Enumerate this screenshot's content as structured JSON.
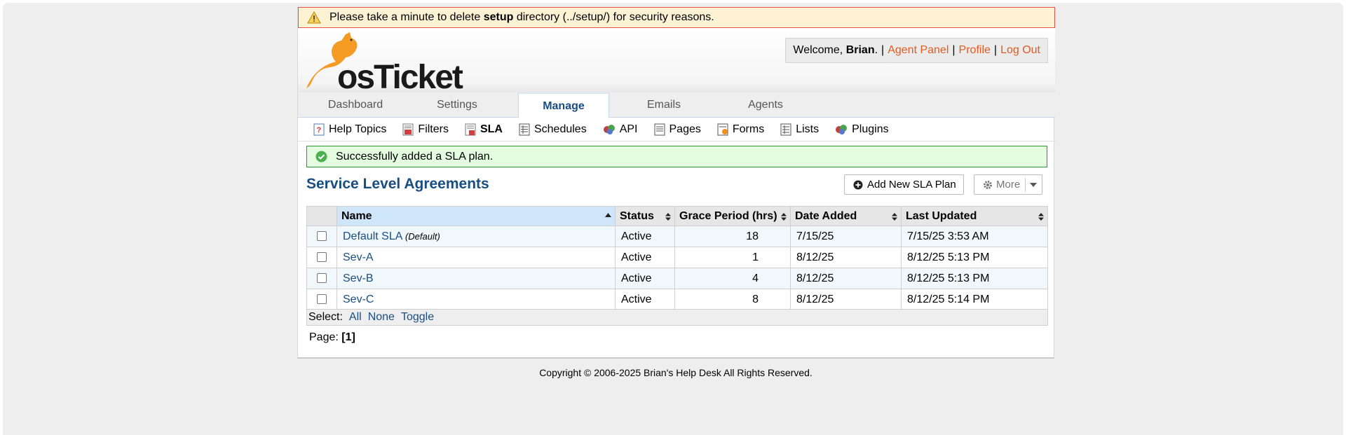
{
  "warning": {
    "prefix": "Please take a minute to delete",
    "bold": "setup",
    "suffix": "directory (../setup/) for security reasons."
  },
  "header": {
    "logo_text": "osTicket",
    "welcome_prefix": "Welcome,",
    "user_name": "Brian",
    "links": [
      "Agent Panel",
      "Profile",
      "Log Out"
    ]
  },
  "nav": {
    "tabs": [
      "Dashboard",
      "Settings",
      "Manage",
      "Emails",
      "Agents"
    ],
    "active": "Manage"
  },
  "subnav": {
    "items": [
      "Help Topics",
      "Filters",
      "SLA",
      "Schedules",
      "API",
      "Pages",
      "Forms",
      "Lists",
      "Plugins"
    ],
    "active": "SLA"
  },
  "success_message": "Successfully added a SLA plan.",
  "page_title": "Service Level Agreements",
  "buttons": {
    "add_label": "Add New SLA Plan",
    "more_label": "More"
  },
  "table": {
    "columns": [
      "Name",
      "Status",
      "Grace Period (hrs)",
      "Date Added",
      "Last Updated"
    ],
    "rows": [
      {
        "name": "Default SLA",
        "tag": "(Default)",
        "status": "Active",
        "grace": "18",
        "added": "7/15/25",
        "updated": "7/15/25 3:53 AM"
      },
      {
        "name": "Sev-A",
        "tag": "",
        "status": "Active",
        "grace": "1",
        "added": "8/12/25",
        "updated": "8/12/25 5:13 PM"
      },
      {
        "name": "Sev-B",
        "tag": "",
        "status": "Active",
        "grace": "4",
        "added": "8/12/25",
        "updated": "8/12/25 5:13 PM"
      },
      {
        "name": "Sev-C",
        "tag": "",
        "status": "Active",
        "grace": "8",
        "added": "8/12/25",
        "updated": "8/12/25 5:14 PM"
      }
    ]
  },
  "select": {
    "label": "Select:",
    "options": [
      "All",
      "None",
      "Toggle"
    ]
  },
  "pager": {
    "label": "Page:",
    "current": "[1]"
  },
  "footer": "Copyright © 2006-2025 Brian's Help Desk All Rights Reserved.",
  "colors": {
    "accent": "#184e81",
    "link_orange": "#e05c20",
    "success_bg": "#e4fde0",
    "warning_bg": "#fdf2d4"
  }
}
